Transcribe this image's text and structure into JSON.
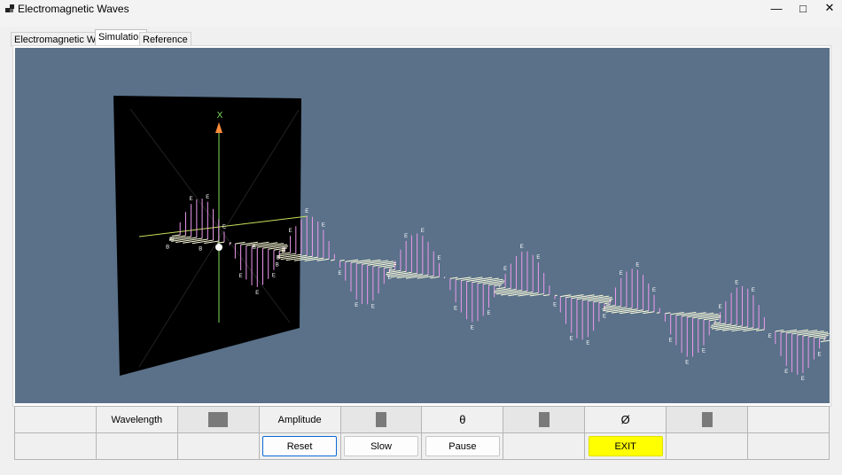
{
  "window": {
    "title": "Electromagnetic Waves"
  },
  "tabs": [
    {
      "label": "Electromagnetic Waves",
      "active": false
    },
    {
      "label": "Simulation",
      "active": true
    },
    {
      "label": "Reference",
      "active": false
    }
  ],
  "scene": {
    "axis_label": "X",
    "background": "#5a7189",
    "e_vector_color": "#ee99ee",
    "b_vector_color": "#ffffdd",
    "e_label": "E",
    "b_label": "B"
  },
  "controls": {
    "wavelength_label": "Wavelength",
    "amplitude_label": "Amplitude",
    "theta_label": "θ",
    "phi_label": "Ø",
    "reset_label": "Reset",
    "slow_label": "Slow",
    "pause_label": "Pause",
    "exit_label": "EXIT",
    "exit_color": "#ffff00"
  }
}
